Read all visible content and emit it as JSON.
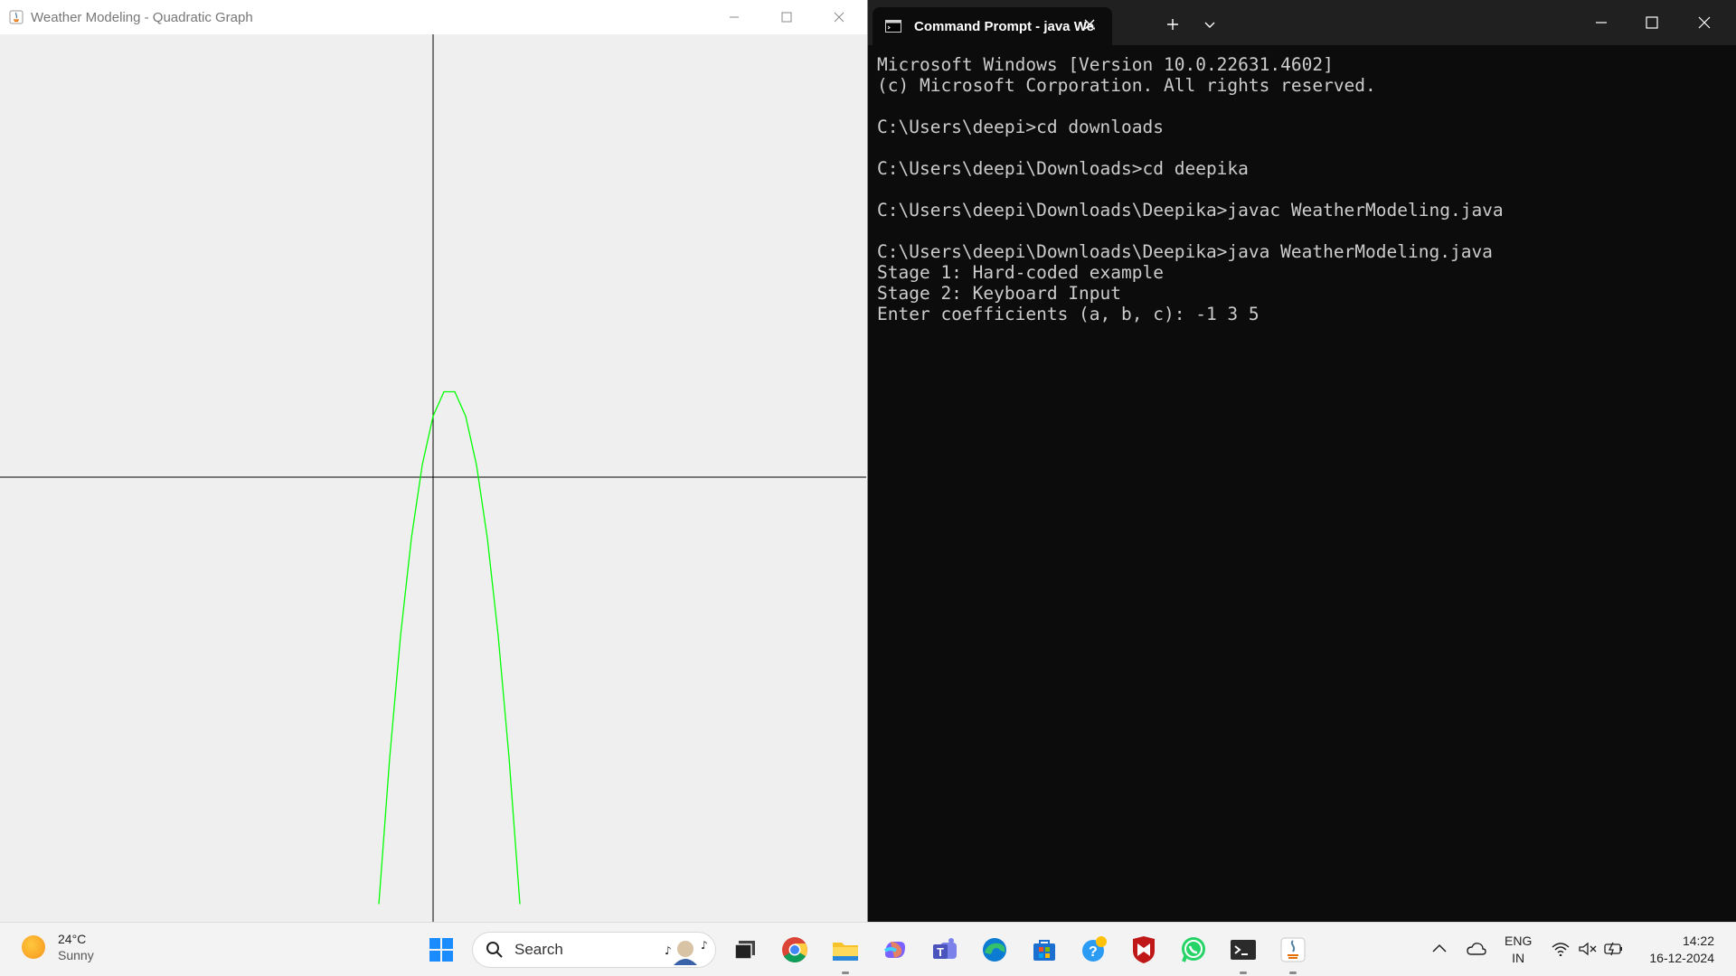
{
  "java_window": {
    "title": "Weather Modeling - Quadratic Graph",
    "controls": {
      "minimize": "minimize",
      "maximize": "maximize",
      "close": "close"
    }
  },
  "graph": {
    "coefficients": {
      "a": -1,
      "b": 3,
      "c": 5
    },
    "curve_color": "#00ff00",
    "axis_color": "#000000",
    "background": "#efefef"
  },
  "terminal": {
    "tab_title": "Command Prompt - java  WeatherModeling.java",
    "lines": [
      "Microsoft Windows [Version 10.0.22631.4602]",
      "(c) Microsoft Corporation. All rights reserved.",
      "",
      "C:\\Users\\deepi>cd downloads",
      "",
      "C:\\Users\\deepi\\Downloads>cd deepika",
      "",
      "C:\\Users\\deepi\\Downloads\\Deepika>javac WeatherModeling.java",
      "",
      "C:\\Users\\deepi\\Downloads\\Deepika>java WeatherModeling.java",
      "Stage 1: Hard-coded example",
      "Stage 2: Keyboard Input",
      "Enter coefficients (a, b, c): -1 3 5"
    ]
  },
  "taskbar": {
    "weather": {
      "temperature": "24°C",
      "condition": "Sunny"
    },
    "search_placeholder": "Search",
    "apps": [
      "start-icon",
      "task-view-icon",
      "chrome-icon",
      "file-explorer-icon",
      "copilot-icon",
      "teams-icon",
      "edge-icon",
      "store-icon",
      "tips-icon",
      "mcafee-icon",
      "whatsapp-icon",
      "terminal-icon",
      "java-icon"
    ],
    "language": {
      "line1": "ENG",
      "line2": "IN"
    },
    "clock": {
      "time": "14:22",
      "date": "16-12-2024"
    }
  }
}
